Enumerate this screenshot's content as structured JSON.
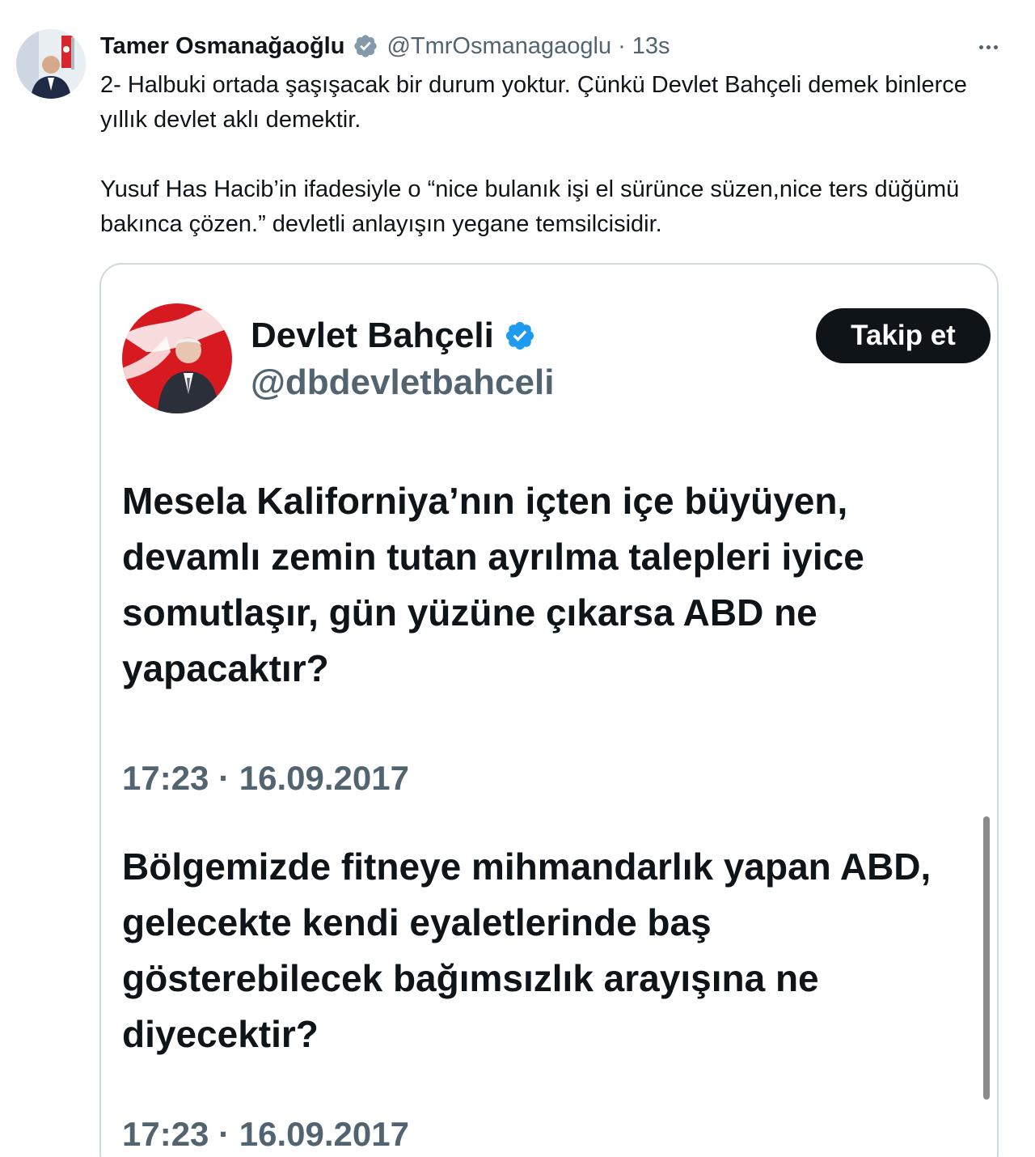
{
  "author": {
    "name": "Tamer Osmanağaoğlu",
    "handle": "@TmrOsmanagaoglu",
    "separator": "·",
    "time": "13s",
    "verified_icon": "verified-badge-grey-icon",
    "verified_color": "#829aab"
  },
  "more_icon": "more-dots-icon",
  "tweet": {
    "paragraphs": [
      "2- Halbuki ortada şaşışacak bir durum yoktur. Çünkü Devlet Bahçeli demek binlerce yıllık devlet aklı demektir.",
      "Yusuf Has Hacib’in ifadesiyle o “nice bulanık işi el sürünce süzen,nice ters düğümü bakınca çözen.” devletli anlayışın yegane temsilcisidir."
    ]
  },
  "embedded": {
    "name": "Devlet Bahçeli",
    "handle": "@dbdevletbahceli",
    "verified_icon": "verified-badge-blue-icon",
    "verified_color": "#1d9bf0",
    "follow_label": "Takip et",
    "posts": [
      {
        "text": "Mesela Kaliforniya’nın içten içe büyüyen, devamlı zemin tutan ayrılma talepleri iyice somutlaşır, gün yüzüne çıkarsa ABD ne yapacaktır?",
        "timestamp": "17:23 · 16.09.2017"
      },
      {
        "text": "Bölgemizde fitneye mihmandarlık yapan ABD, gelecekte kendi eyaletlerinde baş gösterebilecek bağımsızlık arayışına ne diyecektir?",
        "timestamp": "17:23 · 16.09.2017"
      }
    ]
  },
  "colors": {
    "text": "#0f1419",
    "secondary": "#536471",
    "border": "#cfd9de",
    "button_bg": "#0f1419",
    "button_text": "#ffffff"
  }
}
